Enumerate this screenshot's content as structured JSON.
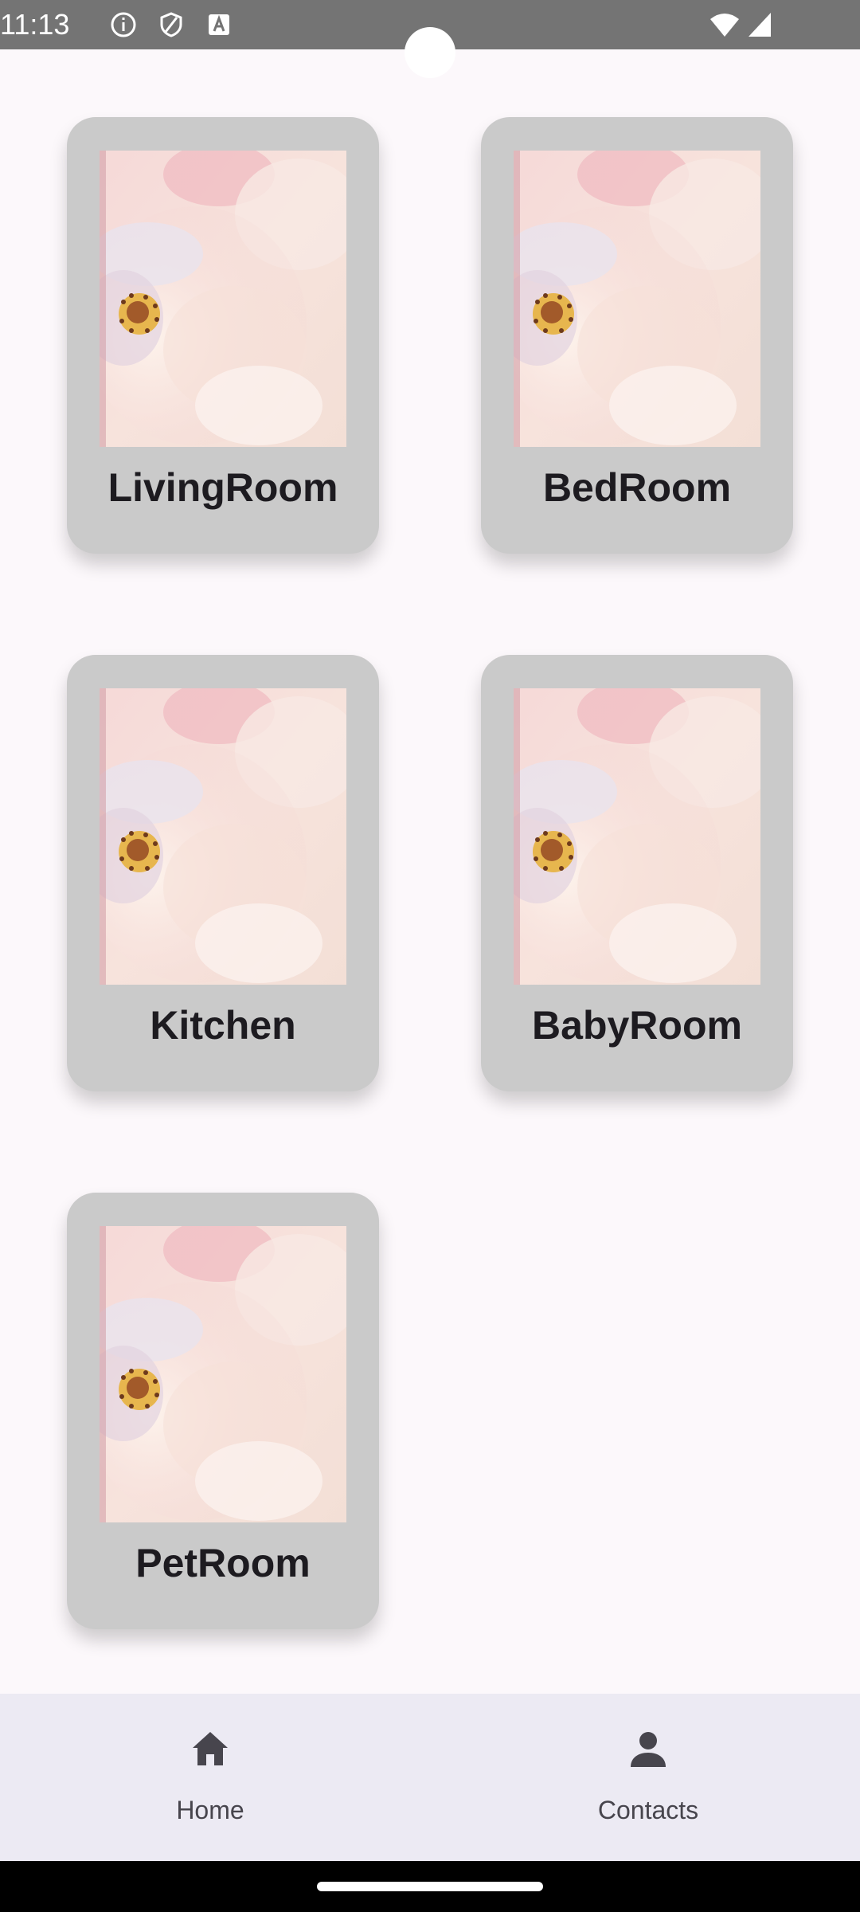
{
  "status_bar": {
    "time": "11:13",
    "icons": [
      "info-icon",
      "shield-icon",
      "keyboard-a-icon",
      "wifi-icon",
      "signal-icon"
    ]
  },
  "rooms": [
    {
      "label": "LivingRoom",
      "image": "flower-photo"
    },
    {
      "label": "BedRoom",
      "image": "flower-photo"
    },
    {
      "label": "Kitchen",
      "image": "flower-photo"
    },
    {
      "label": "BabyRoom",
      "image": "flower-photo"
    },
    {
      "label": "PetRoom",
      "image": "flower-photo"
    }
  ],
  "bottom_nav": {
    "items": [
      {
        "label": "Home",
        "icon": "home-icon"
      },
      {
        "label": "Contacts",
        "icon": "person-icon"
      }
    ]
  },
  "colors": {
    "background": "#fcf8fb",
    "card": "#cacaca",
    "nav_bar": "#eceaf3",
    "text": "#1d1b20"
  }
}
